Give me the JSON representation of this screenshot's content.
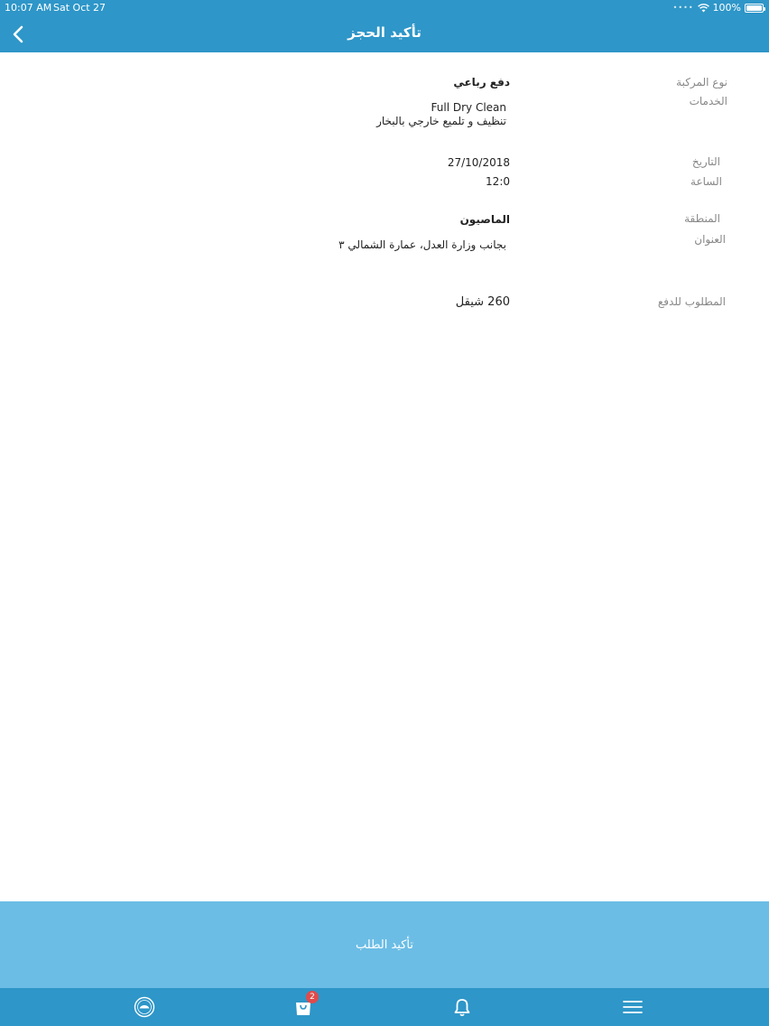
{
  "status": {
    "time": "10:07 AM",
    "date": "Sat Oct 27",
    "battery": "100%"
  },
  "nav": {
    "title": "تأكيد الحجز"
  },
  "vehicle": {
    "label": "نوع المركبة",
    "value": "دفع رباعي"
  },
  "services": {
    "label": "الخدمات",
    "name": "Full Dry Clean",
    "description": "تنظيف و تلميع خارجي بالبخار"
  },
  "date": {
    "label": "التاريخ",
    "value": "27/10/2018"
  },
  "time": {
    "label": "الساعة",
    "value": "12:0"
  },
  "area": {
    "label": "المنطقة",
    "value": "الماصيون"
  },
  "address": {
    "label": "العنوان",
    "value": "بجانب وزارة العدل، عمارة الشمالي ٣"
  },
  "payment": {
    "label": "المطلوب للدفع",
    "value": "260 شيقل"
  },
  "confirm_button": {
    "label": "تأكيد الطلب"
  },
  "tabbar": {
    "cart_badge": "2",
    "icons": [
      "logo-icon",
      "cart-icon",
      "bell-icon",
      "menu-icon"
    ]
  },
  "colors": {
    "primary": "#2e96c8",
    "button": "#6bbde5",
    "badge": "#e04b4b"
  }
}
